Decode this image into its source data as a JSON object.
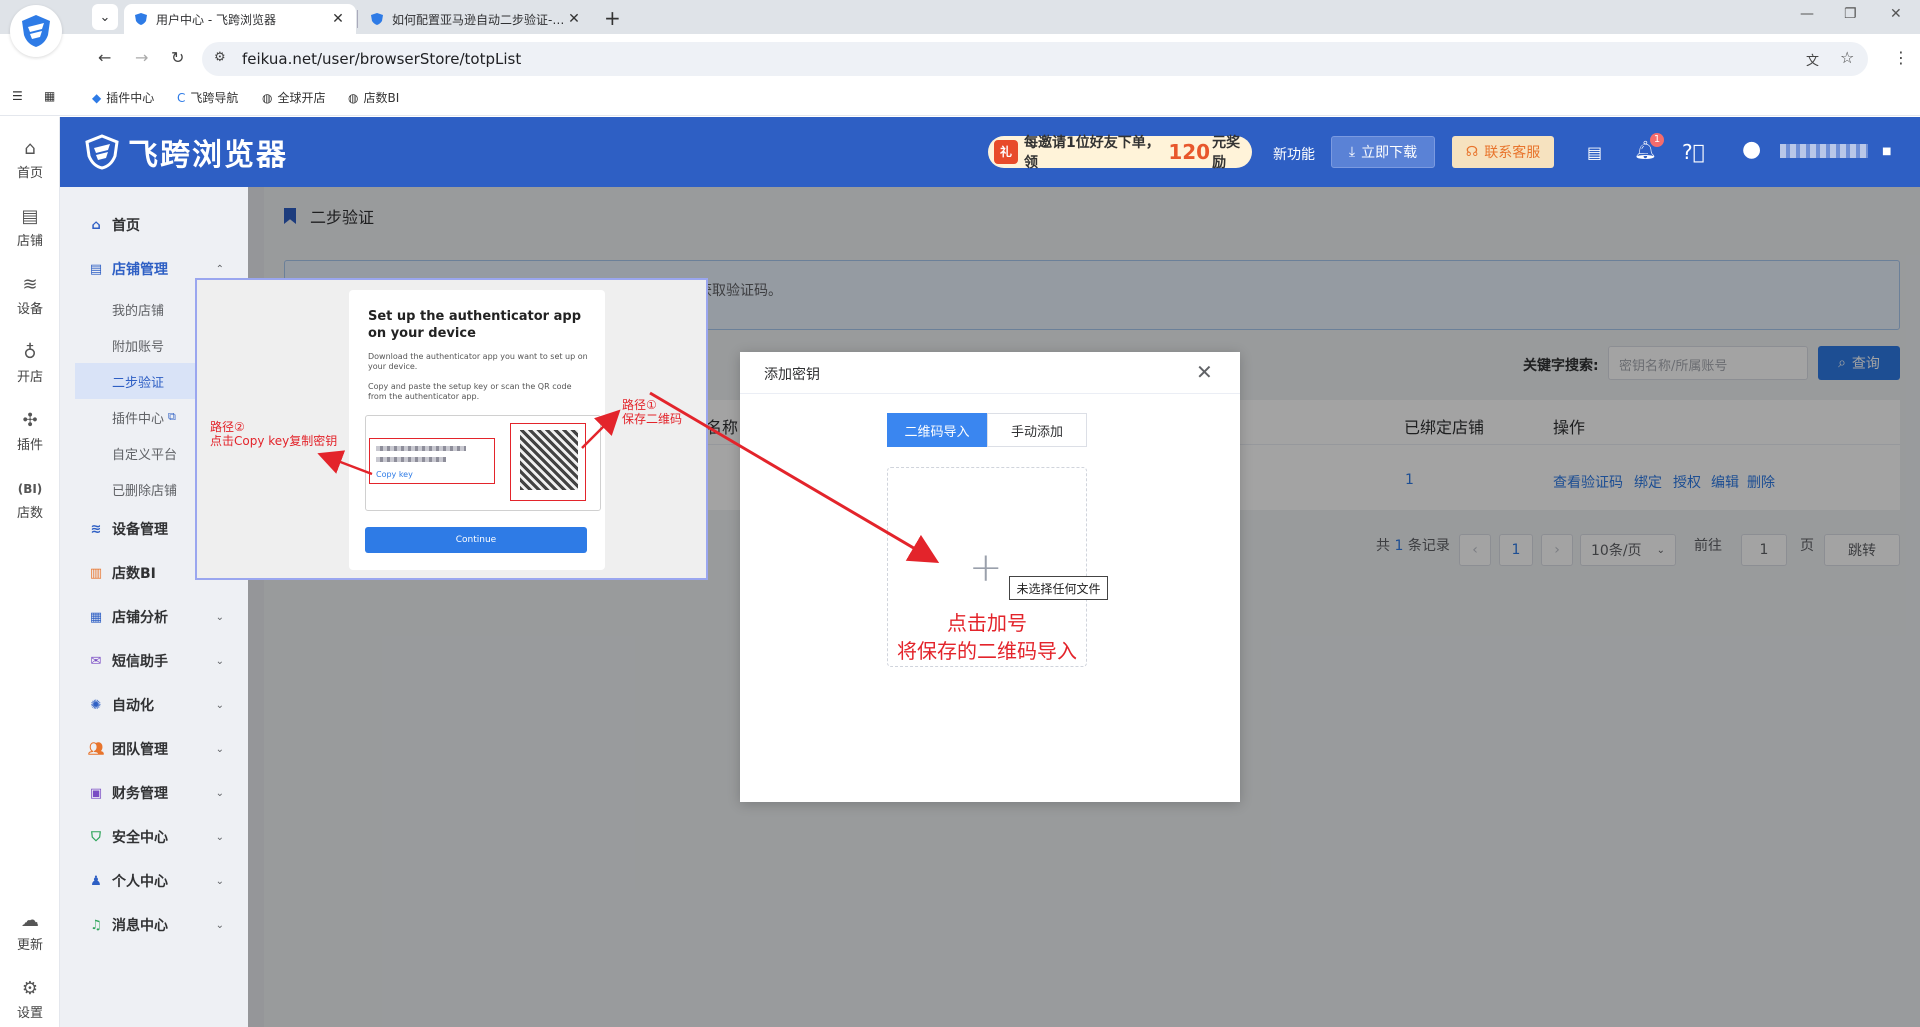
{
  "browser": {
    "tabs": [
      {
        "title": "用户中心 - 飞跨浏览器",
        "active": true
      },
      {
        "title": "如何配置亚马逊自动二步验证-…",
        "active": false
      }
    ],
    "url": "feikua.net/user/browserStore/totpList",
    "bookmarks": [
      "插件中心",
      "飞跨导航",
      "全球开店",
      "店数BI"
    ]
  },
  "rail": [
    "首页",
    "店铺",
    "设备",
    "开店",
    "插件",
    "店数",
    "更新",
    "设置"
  ],
  "header": {
    "brand": "飞跨浏览器",
    "invite_pre": "每邀请1位好友下单，领",
    "invite_amount": "120",
    "invite_post": "元奖励",
    "new_feature": "新功能",
    "download": "立即下载",
    "support": "联系客服",
    "notify_count": "1"
  },
  "sidebar": {
    "home": "首页",
    "store_mgmt": "店铺管理",
    "subs": [
      "我的店铺",
      "附加账号",
      "二步验证",
      "插件中心",
      "自定义平台",
      "已删除店铺"
    ],
    "groups": [
      "设备管理",
      "店数BI",
      "店铺分析",
      "短信助手",
      "自动化",
      "团队管理",
      "财务管理",
      "安全中心",
      "个人中心",
      "消息中心"
    ]
  },
  "page": {
    "breadcrumb": "二步验证",
    "info_tail": "获取验证码。",
    "keyword_label": "关键字搜索:",
    "keyword_placeholder": "密钥名称/所属账号",
    "query": "查询",
    "columns": [
      "名称",
      "已绑定店铺",
      "操作"
    ],
    "row": {
      "bound": "1",
      "actions": [
        "查看验证码",
        "绑定",
        "授权",
        "编辑",
        "删除"
      ]
    },
    "pagination": {
      "total_pre": "共",
      "total": "1",
      "total_post": "条记录",
      "page": "1",
      "page_size": "10条/页",
      "goto": "前往",
      "goto_page": "1",
      "page_unit": "页",
      "jump": "跳转"
    }
  },
  "screenshot": {
    "title": "Set up the authenticator app on your device",
    "p1": "Download the authenticator app you want to set up on your device.",
    "p2": "Copy and paste the setup key or scan the QR code from the authenticator app.",
    "copy_key": "Copy key",
    "continue": "Continue",
    "anno1_a": "路径①",
    "anno1_b": "保存二维码",
    "anno2_a": "路径②",
    "anno2_b": "点击Copy key复制密钥"
  },
  "dialog": {
    "title": "添加密钥",
    "tab_qr": "二维码导入",
    "tab_manual": "手动添加",
    "tooltip": "未选择任何文件",
    "note_1": "点击加号",
    "note_2": "将保存的二维码导入"
  }
}
